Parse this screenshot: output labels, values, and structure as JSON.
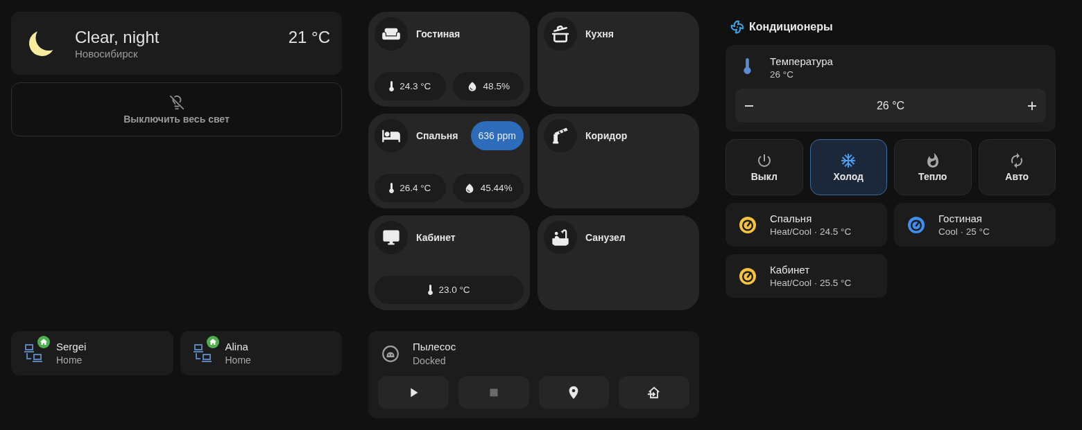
{
  "weather": {
    "condition": "Clear, night",
    "location": "Новосибирск",
    "temperature": "21 °C"
  },
  "lights_button": {
    "label": "Выключить весь свет"
  },
  "persons": [
    {
      "name": "Sergei",
      "state": "Home"
    },
    {
      "name": "Alina",
      "state": "Home"
    }
  ],
  "rooms": [
    {
      "name": "Гостиная",
      "sensors": [
        {
          "kind": "temperature",
          "value": "24.3 °C"
        },
        {
          "kind": "humidity",
          "value": "48.5%"
        }
      ]
    },
    {
      "name": "Кухня"
    },
    {
      "name": "Спальня",
      "badge": "636 ppm",
      "sensors": [
        {
          "kind": "temperature",
          "value": "26.4 °C"
        },
        {
          "kind": "humidity",
          "value": "45.44%"
        }
      ]
    },
    {
      "name": "Коридор"
    },
    {
      "name": "Кабинет",
      "sensors": [
        {
          "kind": "temperature",
          "value": "23.0 °C"
        }
      ]
    },
    {
      "name": "Санузел"
    }
  ],
  "vacuum": {
    "name": "Пылесос",
    "state": "Docked",
    "buttons": [
      {
        "kind": "start",
        "disabled": false
      },
      {
        "kind": "stop",
        "disabled": true
      },
      {
        "kind": "locate",
        "disabled": false
      },
      {
        "kind": "return_home",
        "disabled": false
      }
    ]
  },
  "climate": {
    "title": "Кондиционеры",
    "temperature": {
      "name": "Температура",
      "state": "26 °C",
      "target": "26 °C"
    },
    "modes": [
      {
        "kind": "off",
        "label": "Выкл",
        "selected": false
      },
      {
        "kind": "cool",
        "label": "Холод",
        "selected": true
      },
      {
        "kind": "heat",
        "label": "Тепло",
        "selected": false
      },
      {
        "kind": "auto",
        "label": "Авто",
        "selected": false
      }
    ],
    "units": [
      {
        "name": "Спальня",
        "state": "Heat/Cool · 24.5 °C",
        "color": "#f8c33c"
      },
      {
        "name": "Гостиная",
        "state": "Cool · 25 °C",
        "color": "#3f8ef0"
      },
      {
        "name": "Кабинет",
        "state": "Heat/Cool · 25.5 °C",
        "color": "#f8c33c"
      }
    ]
  }
}
